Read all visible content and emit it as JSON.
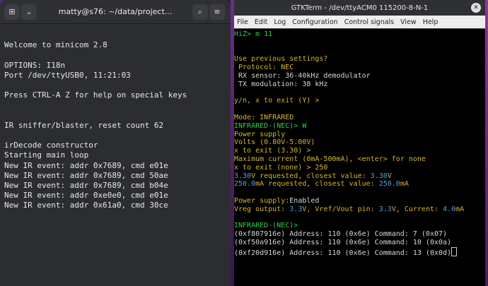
{
  "left_terminal": {
    "title": "matty@s76: ~/data/project...",
    "lines": [
      "",
      "Welcome to minicom 2.8",
      "",
      "OPTIONS: I18n",
      "Port /dev/ttyUSB0, 11:21:03",
      "",
      "Press CTRL-A Z for help on special keys",
      "",
      "",
      "IR sniffer/blaster, reset count 62",
      "",
      "irDecode constructor",
      "Starting main loop",
      "New IR event: addr 0x7689, cmd e01e",
      "New IR event: addr 0x7689, cmd 50ae",
      "New IR event: addr 0x7689, cmd b04e",
      "New IR event: addr 0xe0e0, cmd e01e",
      "New IR event: addr 0x61a0, cmd 30ce"
    ]
  },
  "gtkterm": {
    "title": "GTKTerm - /dev/ttyACM0  115200-8-N-1",
    "menu": [
      "File",
      "Edit",
      "Log",
      "Configuration",
      "Control signals",
      "View",
      "Help"
    ],
    "lines": {
      "l01": "HiZ> m 11",
      "l04": "Use previous settings?",
      "l05": " Protocol: NEC",
      "l06": " RX sensor: 36-40kHz demodulator",
      "l07": " TX modulation: 38 kHz",
      "l09": "y/n, x to exit (Y) >",
      "l11": "Mode: INFRARED",
      "l12": "INFRARED-(NEC)> W",
      "l13": "Power supply",
      "l14": "Volts (0.80V-5.00V)",
      "l15": "x to exit (3.30) >",
      "l16": "Maximum current (0mA-500mA), <enter> for none",
      "l17": "x to exit (none) > 250",
      "l18a": "3.30",
      "l18b": "V requested, closest value: ",
      "l18c": "3.30",
      "l18d": "V",
      "l19a": "250.0",
      "l19b": "mA requested, closest value: ",
      "l19c": "250.0",
      "l19d": "mA",
      "l21a": "Power supply:",
      "l21b": "Enabled",
      "l22a": "Vreg output: ",
      "l22b": "3.3",
      "l22c": "V, Vref/Vout pin: ",
      "l22d": "3.3",
      "l22e": "V, Current: ",
      "l22f": "4.0",
      "l22g": "mA",
      "l24": "INFRARED-(NEC)>",
      "l25": "(0xf807916e) Address: 110 (0x6e) Command: 7 (0x07)",
      "l26": "(0xf50a916e) Address: 110 (0x6e) Command: 10 (0x0a)",
      "l27": "(0xf20d916e) Address: 110 (0x6e) Command: 13 (0x0d)"
    }
  }
}
